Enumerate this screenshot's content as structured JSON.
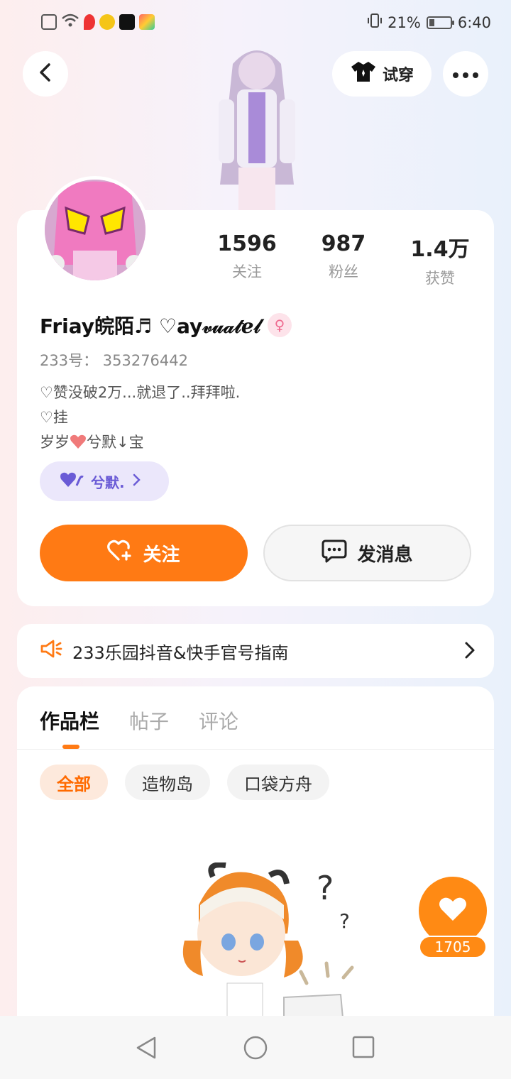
{
  "status_bar": {
    "battery": "21%",
    "time": "6:40"
  },
  "header": {
    "try_on_label": "试穿"
  },
  "stats": [
    {
      "value": "1596",
      "label": "关注"
    },
    {
      "value": "987",
      "label": "粉丝"
    },
    {
      "value": "1.4万",
      "label": "获赞"
    }
  ],
  "profile": {
    "name": "Friay皖陌♬ ♡ay𝓋𝓊𝒶𝓉ℯ𝓁",
    "gender_symbol": "♀",
    "uid": "233号： 353276442",
    "bio_line1": "♡赞没破2万...就退了..拜拜啦.",
    "bio_line2": "♡挂",
    "bio_line3_a": "岁岁",
    "bio_line3_b": "兮默↓宝",
    "tag": "兮默."
  },
  "actions": {
    "follow": "关注",
    "message": "发消息"
  },
  "notice": {
    "text": "233乐园抖音&快手官号指南"
  },
  "tabs": [
    {
      "label": "作品栏"
    },
    {
      "label": "帖子"
    },
    {
      "label": "评论"
    }
  ],
  "chips": [
    {
      "label": "全部"
    },
    {
      "label": "造物岛"
    },
    {
      "label": "口袋方舟"
    }
  ],
  "like": {
    "count": "1705"
  },
  "colors": {
    "accent": "#ff7a14",
    "tag_purple": "#6a5bd6"
  }
}
